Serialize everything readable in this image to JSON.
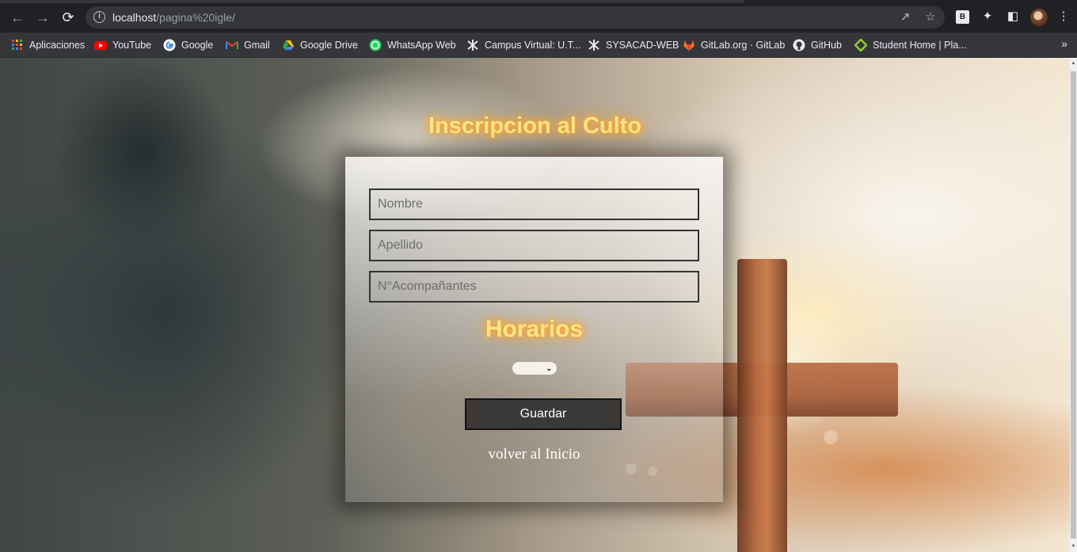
{
  "browser": {
    "url_host": "localhost",
    "url_path": "/pagina%20igle/",
    "extension_badge": "B",
    "bookmarks": [
      {
        "label": "Aplicaciones",
        "icon": "apps-grid-icon"
      },
      {
        "label": "YouTube",
        "icon": "youtube-icon"
      },
      {
        "label": "Google",
        "icon": "google-icon"
      },
      {
        "label": "Gmail",
        "icon": "gmail-icon"
      },
      {
        "label": "Google Drive",
        "icon": "google-drive-icon"
      },
      {
        "label": "WhatsApp Web",
        "icon": "whatsapp-icon"
      },
      {
        "label": "Campus Virtual: U.T...",
        "icon": "utn-icon"
      },
      {
        "label": "SYSACAD-WEB",
        "icon": "utn-icon"
      },
      {
        "label": "GitLab.org · GitLab",
        "icon": "gitlab-icon"
      },
      {
        "label": "GitHub",
        "icon": "github-icon"
      },
      {
        "label": "Student Home | Pla...",
        "icon": "platzi-icon"
      }
    ],
    "more_bookmarks": "»"
  },
  "page": {
    "title": "Inscripcion al Culto",
    "form": {
      "nombre_placeholder": "Nombre",
      "apellido_placeholder": "Apellido",
      "acompanantes_placeholder": "N°Acompañantes",
      "horarios_label": "Horarios",
      "horario_selected": "",
      "save_label": "Guardar",
      "back_link": "volver al Inicio"
    }
  },
  "colors": {
    "heading_text": "#fde58a",
    "heading_glow": "#ff9b1a",
    "button_bg": "#3b3838",
    "field_border": "#333333"
  }
}
